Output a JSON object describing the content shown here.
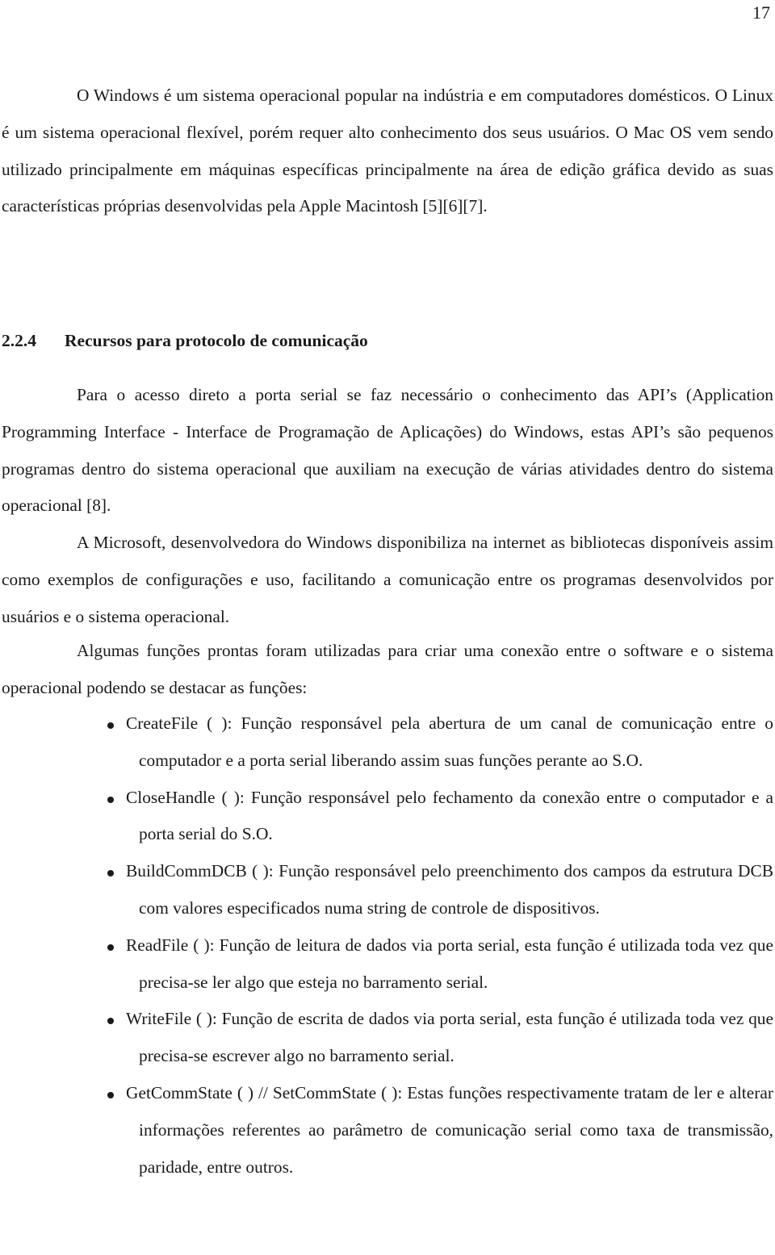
{
  "page": {
    "number": "17"
  },
  "intro_paragraph": "O Windows é um sistema operacional popular na indústria e em computadores domésticos. O Linux é um sistema operacional flexível, porém requer alto conhecimento dos seus usuários. O Mac OS vem sendo utilizado principalmente em máquinas específicas principalmente na área de edição gráfica devido as suas características próprias desenvolvidas pela Apple Macintosh [5][6][7].",
  "section": {
    "number": "2.2.4",
    "title": "Recursos para protocolo de comunicação"
  },
  "paragraphs": [
    "Para o acesso direto a porta serial se faz necessário o conhecimento das API’s (Application Programming Interface - Interface de Programação de Aplicações) do Windows, estas API’s são pequenos programas dentro do sistema operacional que auxiliam na execução de várias atividades dentro do sistema operacional [8].",
    "A Microsoft, desenvolvedora do Windows disponibiliza na internet as bibliotecas disponíveis assim como exemplos de configurações e uso, facilitando a comunicação entre os programas desenvolvidos por usuários e o sistema operacional.",
    "Algumas funções prontas foram utilizadas para criar uma conexão entre o software e o sistema operacional podendo se destacar as funções:"
  ],
  "functions": [
    {
      "text": "CreateFile ( ): Função responsável pela abertura de um canal de comunicação entre o computador e a porta serial liberando assim suas funções perante ao S.O."
    },
    {
      "text": "CloseHandle ( ): Função responsável pelo fechamento da conexão entre o computador e a porta serial do S.O."
    },
    {
      "text": "BuildCommDCB ( ): Função responsável pelo preenchimento dos campos da estrutura DCB com valores especificados numa string de controle de dispositivos."
    },
    {
      "text": "ReadFile ( ): Função de leitura de dados via porta serial, esta função é utilizada toda vez que precisa-se ler algo que esteja no barramento serial."
    },
    {
      "text": "WriteFile ( ): Função de escrita de dados via porta serial, esta função é utilizada toda vez que precisa-se escrever algo no barramento serial."
    },
    {
      "text": "GetCommState ( ) // SetCommState ( ): Estas funções respectivamente tratam de ler e alterar informações referentes ao parâmetro de comunicação serial como taxa de transmissão, paridade, entre outros."
    }
  ]
}
